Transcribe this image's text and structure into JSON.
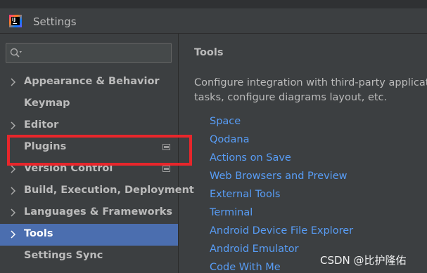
{
  "window": {
    "title": "Settings"
  },
  "search": {
    "placeholder": ""
  },
  "sidebar": {
    "items": [
      {
        "label": "Appearance & Behavior",
        "expandable": true,
        "selected": false,
        "badge": false
      },
      {
        "label": "Keymap",
        "expandable": false,
        "selected": false,
        "badge": false
      },
      {
        "label": "Editor",
        "expandable": true,
        "selected": false,
        "badge": false
      },
      {
        "label": "Plugins",
        "expandable": false,
        "selected": false,
        "badge": true
      },
      {
        "label": "Version Control",
        "expandable": true,
        "selected": false,
        "badge": true
      },
      {
        "label": "Build, Execution, Deployment",
        "expandable": true,
        "selected": false,
        "badge": false
      },
      {
        "label": "Languages & Frameworks",
        "expandable": true,
        "selected": false,
        "badge": false
      },
      {
        "label": "Tools",
        "expandable": true,
        "selected": true,
        "badge": false
      },
      {
        "label": "Settings Sync",
        "expandable": false,
        "selected": false,
        "badge": false
      }
    ]
  },
  "main": {
    "heading": "Tools",
    "description_line1": "Configure integration with third-party application",
    "description_line2": "tasks, configure diagrams layout, etc.",
    "links": [
      "Space",
      "Qodana",
      "Actions on Save",
      "Web Browsers and Preview",
      "External Tools",
      "Terminal",
      "Android Device File Explorer",
      "Android Emulator",
      "Code With Me"
    ]
  },
  "watermark": "CSDN @比护隆佑",
  "colors": {
    "background": "#3c3f41",
    "selection": "#4b6eaf",
    "link": "#589df6",
    "highlight": "#e8262b"
  }
}
